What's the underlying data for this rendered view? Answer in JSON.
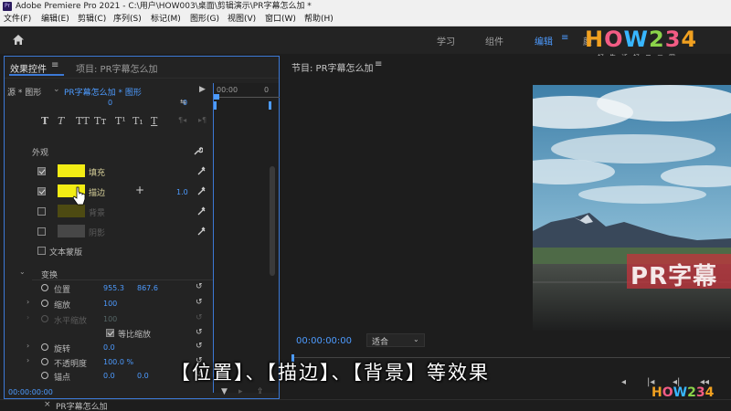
{
  "titlebar": {
    "logo": "Pr",
    "title": "Adobe Premiere Pro 2021 - C:\\用户\\HOW003\\桌面\\剪辑演示\\PR字幕怎么加 *"
  },
  "menu": [
    "文件(F)",
    "编辑(E)",
    "剪辑(C)",
    "序列(S)",
    "标记(M)",
    "图形(G)",
    "视图(V)",
    "窗口(W)",
    "帮助(H)"
  ],
  "workspaces": {
    "items": [
      "学习",
      "组件",
      "编辑",
      "颜"
    ],
    "active": "编辑",
    "menu_icon": "≡"
  },
  "brand": {
    "name": "HOW234",
    "tagline": "好生活好二三四",
    "watermark": "HOW234"
  },
  "effects_panel": {
    "tab_active": "效果控件",
    "tab_menu": "≡",
    "tab_project": "项目: PR字幕怎么加",
    "source_label": "源 * 图形",
    "clip_label": "PR字幕怎么加 * 图形",
    "timecode_start": "00:00",
    "timecode_end": "0",
    "top_values": [
      "0",
      "0"
    ],
    "text_style_buttons": [
      "T",
      "T",
      "TT",
      "Tт",
      "T¹",
      "T₁",
      "T"
    ],
    "appearance_label": "外观",
    "fill_label": "填充",
    "stroke_label": "描边",
    "stroke_width": "1.0",
    "background_label": "背景",
    "shadow_label": "阴影",
    "text_mask_label": "文本蒙版",
    "transform_label": "变换",
    "position_label": "位置",
    "position_x": "955.3",
    "position_y": "867.6",
    "scale_label": "缩放",
    "scale_value": "100",
    "scale_width_label": "水平缩放",
    "scale_width_value": "100",
    "uniform_scale_label": "等比缩放",
    "rotation_label": "旋转",
    "rotation_value": "0.0",
    "opacity_label": "不透明度",
    "opacity_value": "100.0 %",
    "anchor_label": "锚点",
    "anchor_x": "0.0",
    "anchor_y": "0.0",
    "bottom_timecode": "00:00:00:00"
  },
  "colors": {
    "fill": "#f2ec14",
    "stroke": "#f2ec14",
    "accent": "#4d9bff",
    "panel_border": "#3c79d6"
  },
  "program": {
    "title": "节目: PR字幕怎么加",
    "menu_icon": "≡",
    "timecode": "00:00:00:00",
    "fit_value": "适合",
    "caption_text": "PR字幕",
    "transport_icons": [
      "◂",
      "|◂",
      "◂|",
      "◂◂"
    ]
  },
  "sequence_tab": {
    "close": "×",
    "label": "PR字幕怎么加"
  },
  "overlay_subtitle": "【位置】、【描边】、【背景】等效果"
}
